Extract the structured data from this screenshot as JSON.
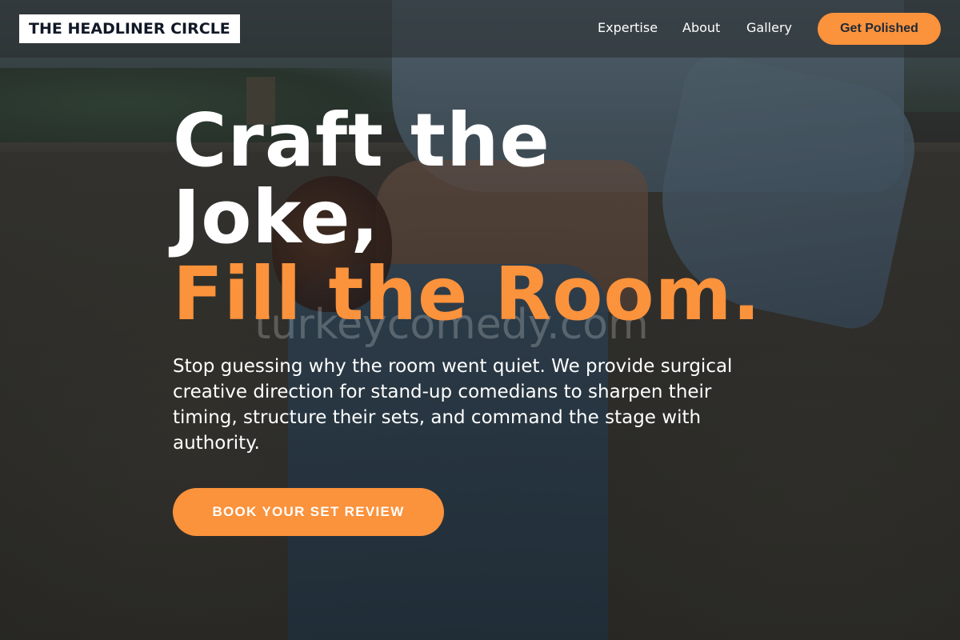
{
  "header": {
    "logo_text": "THE HEADLINER CIRCLE",
    "nav": [
      "Expertise",
      "About",
      "Gallery"
    ],
    "cta_label": "Get Polished"
  },
  "hero": {
    "title_line1": "Craft the",
    "title_line2": "Joke,",
    "title_line3": "Fill the Room.",
    "subtitle": "Stop guessing why the room went quiet. We provide surgical creative direction for stand-up comedians to sharpen their timing, structure their sets, and command the stage with authority.",
    "cta_label": "BOOK YOUR SET REVIEW",
    "watermark": "turkeycomedy.com"
  },
  "colors": {
    "accent": "#fb923c",
    "logo_background": "#ffffff",
    "text": "#ffffff"
  }
}
